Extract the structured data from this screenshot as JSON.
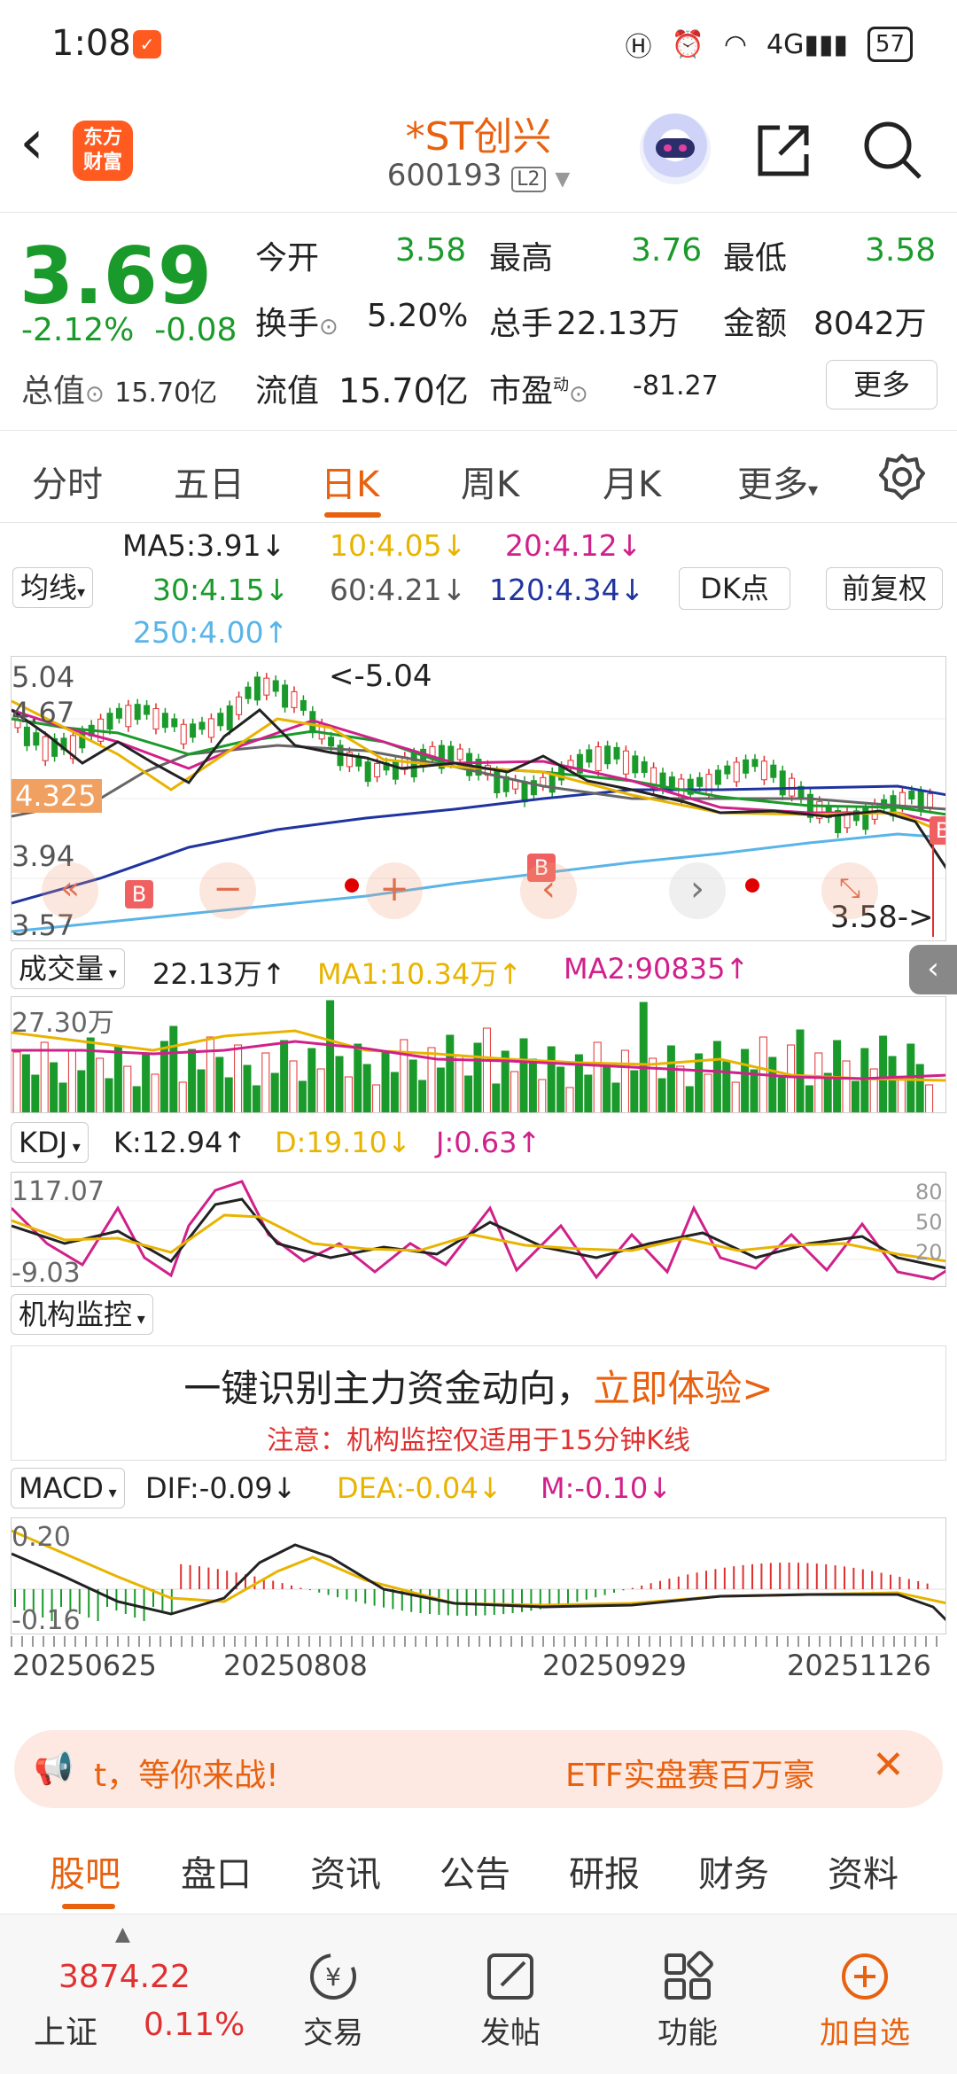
{
  "status_bar": {
    "time": "1:08",
    "battery": "57"
  },
  "header": {
    "name": "*ST创兴",
    "code": "600193",
    "level": "L2",
    "logo_line1": "东方",
    "logo_line2": "财富"
  },
  "quote": {
    "price": "3.69",
    "change_pct": "-2.12%",
    "change": "-0.08",
    "total_value_label": "总值",
    "total_value": "15.70亿",
    "open_label": "今开",
    "open": "3.58",
    "high_label": "最高",
    "high": "3.76",
    "low_label": "最低",
    "low": "3.58",
    "turnover_label": "换手",
    "turnover": "5.20%",
    "volume_label": "总手",
    "volume": "22.13万",
    "amount_label": "金额",
    "amount": "8042万",
    "float_label": "流值",
    "float_value": "15.70亿",
    "pe_label": "市盈",
    "pe_sup": "动",
    "pe": "-81.27",
    "more": "更多"
  },
  "period_tabs": [
    "分时",
    "五日",
    "日K",
    "周K",
    "月K",
    "更多"
  ],
  "ma_legend": {
    "selector": "均线",
    "ma5": "MA5:3.91↓",
    "ma10": "10:4.05↓",
    "ma20": "20:4.12↓",
    "ma30": "30:4.15↓",
    "ma60": "60:4.21↓",
    "ma120": "120:4.34↓",
    "ma250": "250:4.00↑",
    "dk": "DK点",
    "adjust": "前复权"
  },
  "kline": {
    "y_top": "5.04",
    "y_2": "4.67",
    "y_cur": "4.325",
    "y_3": "3.94",
    "y_bottom": "3.57",
    "high_mark": "<-5.04",
    "low_mark": "3.58->",
    "b_label": "B"
  },
  "volume": {
    "label": "成交量",
    "value": "22.13万↑",
    "ma1": "MA1:10.34万↑",
    "ma2": "MA2:90835↑",
    "axis": "27.30万"
  },
  "kdj": {
    "label": "KDJ",
    "k": "K:12.94↑",
    "d": "D:19.10↓",
    "j": "J:0.63↑",
    "top": "117.07",
    "bottom": "-9.03",
    "r80": "80",
    "r50": "50",
    "r20": "20"
  },
  "institution": {
    "label": "机构监控",
    "line1": "一键识别主力资金动向，",
    "cta": "立即体验>",
    "line2": "注意：机构监控仅适用于15分钟K线"
  },
  "macd": {
    "label": "MACD",
    "dif": "DIF:-0.09↓",
    "dea": "DEA:-0.04↓",
    "m": "M:-0.10↓",
    "top": "0.20",
    "bottom": "-0.16"
  },
  "dates": [
    "20250625",
    "20250808",
    "20250929",
    "20251126"
  ],
  "banner": {
    "text1": "t，等你来战!",
    "text2": "ETF实盘赛百万豪"
  },
  "sub_tabs": [
    "股吧",
    "盘口",
    "资讯",
    "公告",
    "研报",
    "财务",
    "资料"
  ],
  "bottom_nav": {
    "index_value": "3874.22",
    "index_name": "上证",
    "index_change": "0.11%",
    "trade": "交易",
    "post": "发帖",
    "functions": "功能",
    "add": "加自选"
  },
  "colors": {
    "up": "#e03030",
    "down": "#1a9a2a",
    "accent": "#e8610f",
    "ma5": "#222222",
    "ma10": "#e8b400",
    "ma20": "#d0208a",
    "ma30": "#1a9a2a",
    "ma60": "#666666",
    "ma120": "#2034a0",
    "ma250": "#59b4e8"
  }
}
